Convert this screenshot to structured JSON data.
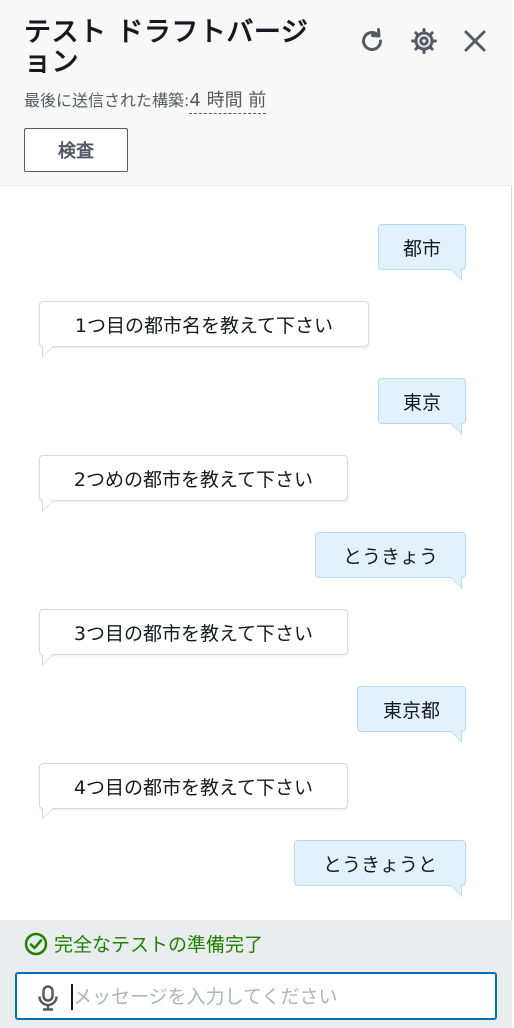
{
  "header": {
    "title": "テスト ドラフトバージョン",
    "subtitle_prefix": "最後に送信された構築:",
    "subtitle_ago": "4 時間 前",
    "inspect_label": "検査"
  },
  "messages": [
    {
      "role": "user",
      "text": "都市"
    },
    {
      "role": "bot",
      "text": "1つ目の都市名を教えて下さい"
    },
    {
      "role": "user",
      "text": "東京"
    },
    {
      "role": "bot",
      "text": "2つめの都市を教えて下さい"
    },
    {
      "role": "user",
      "text": "とうきょう"
    },
    {
      "role": "bot",
      "text": "3つ目の都市を教えて下さい"
    },
    {
      "role": "user",
      "text": "東京都"
    },
    {
      "role": "bot",
      "text": "4つ目の都市を教えて下さい"
    },
    {
      "role": "user",
      "text": "とうきょうと"
    }
  ],
  "footer": {
    "status_text": "完全なテストの準備完了",
    "input_placeholder": "メッセージを入力してください",
    "input_value": ""
  },
  "icons": {
    "refresh": "refresh-icon",
    "settings": "gear-icon",
    "close": "close-icon",
    "status": "check-circle-icon",
    "mic": "microphone-icon"
  },
  "colors": {
    "user_bubble": "#e3f1fc",
    "bot_bubble": "#ffffff",
    "success": "#1d8102",
    "focus": "#0073bb"
  }
}
